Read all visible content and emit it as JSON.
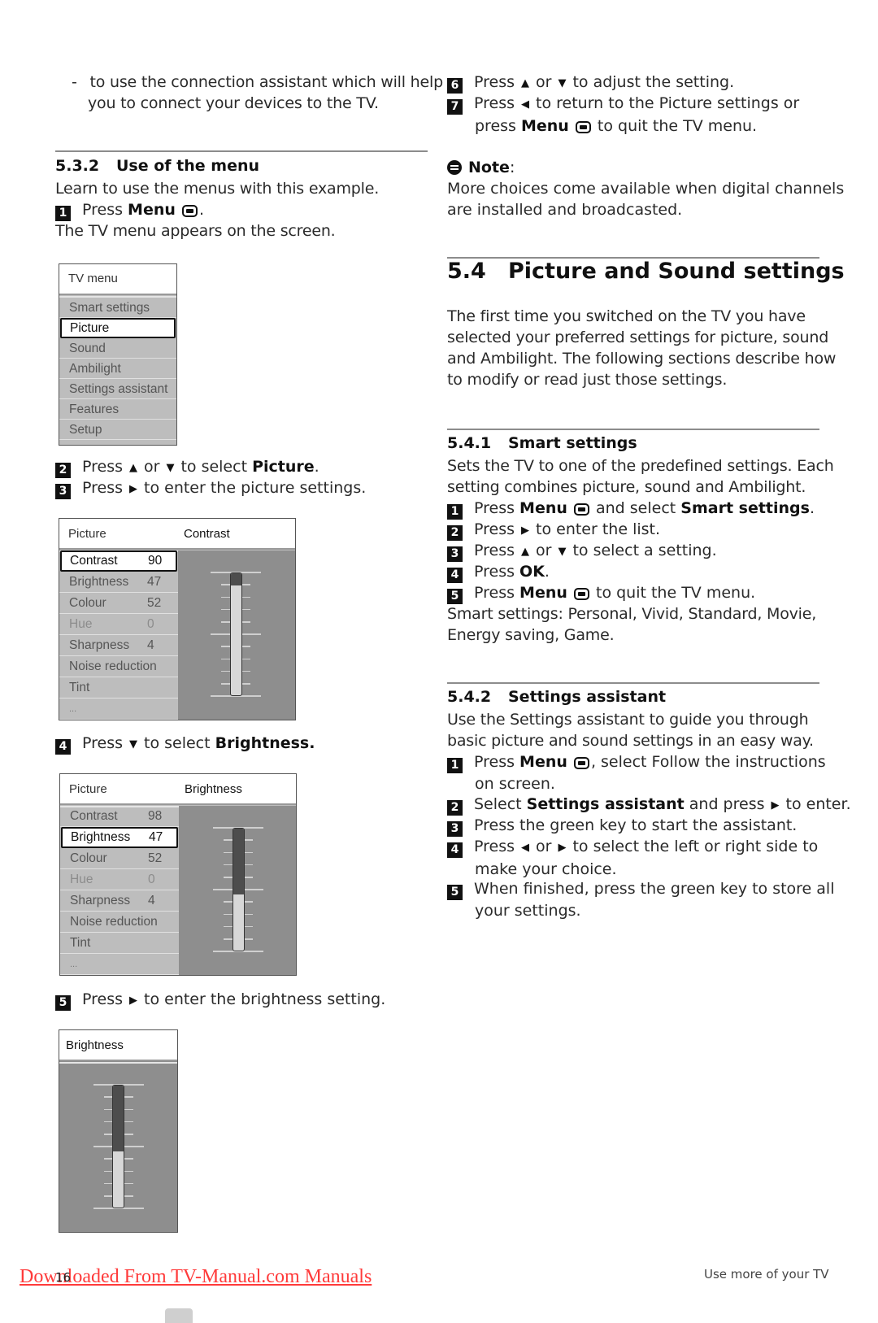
{
  "left": {
    "intro_bullet": {
      "dash": "-",
      "line1": "to use the connection assistant which will help",
      "line2": "you to connect your devices to the TV."
    },
    "section_532": {
      "number": "5.3.2",
      "title": "Use of the menu",
      "intro": "Learn to use the menus with this example.",
      "step1": {
        "n": "1",
        "pre": "Press ",
        "bold": "Menu",
        "post": "."
      },
      "after_step1": "The TV menu appears on the screen.",
      "step2": {
        "n": "2",
        "pre": "Press",
        "up": "▲",
        "or": "or",
        "down": "▼",
        "mid": "to select ",
        "bold": "Picture",
        "post": "."
      },
      "step3": {
        "n": "3",
        "pre": "Press",
        "right": "▶",
        "post": "to enter the picture settings."
      },
      "step4": {
        "n": "4",
        "pre": "Press",
        "down": "▼",
        "mid": "to select ",
        "bold": "Brightness."
      },
      "step5": {
        "n": "5",
        "pre": "Press",
        "right": "▶",
        "post": "to enter the brightness setting."
      }
    },
    "tv_menu": {
      "title": "TV menu",
      "items": [
        "Smart settings",
        "Picture",
        "Sound",
        "Ambilight",
        "Settings assistant",
        "Features",
        "Setup"
      ],
      "selected_index": 1
    },
    "picture_contrast": {
      "title": "Picture",
      "right_title": "Contrast",
      "rows": [
        {
          "label": "Contrast",
          "value": "90"
        },
        {
          "label": "Brightness",
          "value": "47"
        },
        {
          "label": "Colour",
          "value": "52"
        },
        {
          "label": "Hue",
          "value": "0"
        },
        {
          "label": "Sharpness",
          "value": "4"
        },
        {
          "label": "Noise reduction",
          "value": ""
        },
        {
          "label": "Tint",
          "value": ""
        },
        {
          "label": "...",
          "value": ""
        }
      ],
      "selected_index": 0,
      "slider_level_percent": 90
    },
    "picture_brightness": {
      "title": "Picture",
      "right_title": "Brightness",
      "rows": [
        {
          "label": "Contrast",
          "value": "98"
        },
        {
          "label": "Brightness",
          "value": "47"
        },
        {
          "label": "Colour",
          "value": "52"
        },
        {
          "label": "Hue",
          "value": "0"
        },
        {
          "label": "Sharpness",
          "value": "4"
        },
        {
          "label": "Noise reduction",
          "value": ""
        },
        {
          "label": "Tint",
          "value": ""
        },
        {
          "label": "...",
          "value": ""
        }
      ],
      "selected_index": 1,
      "slider_level_percent": 47
    },
    "brightness_only": {
      "title": "Brightness",
      "slider_level_percent": 47
    }
  },
  "right": {
    "step6": {
      "n": "6",
      "pre": "Press",
      "up": "▲",
      "or": "or",
      "down": "▼",
      "post": "to adjust the setting."
    },
    "step7": {
      "n": "7",
      "pre": "Press",
      "left": "◀",
      "post": "to return to the Picture settings or",
      "line2_pre": "press ",
      "line2_bold": "Menu",
      "line2_post": " to quit the TV menu."
    },
    "note": {
      "label": "Note",
      "colon": ":",
      "line1": "More choices come available when digital channels",
      "line2": "are installed and broadcasted."
    },
    "section_54": {
      "number": "5.4",
      "title": "Picture and Sound settings",
      "body": [
        "The first time you switched on the TV you have",
        "selected your preferred settings for picture, sound",
        "and Ambilight. The following sections describe how",
        "to modify or read just those settings."
      ]
    },
    "section_541": {
      "number": "5.4.1",
      "title": "Smart settings",
      "body": [
        "Sets the TV to one of the predefined settings. Each",
        "setting combines picture, sound and Ambilight."
      ],
      "step1": {
        "n": "1",
        "pre": "Press ",
        "bold": "Menu",
        "mid": " and select ",
        "bold2": "Smart settings",
        "post": "."
      },
      "step2": {
        "n": "2",
        "pre": "Press",
        "right": "▶",
        "post": "to enter the list."
      },
      "step3": {
        "n": "3",
        "pre": "Press",
        "up": "▲",
        "or": "or",
        "down": "▼",
        "post": "to select a setting."
      },
      "step4": {
        "n": "4",
        "pre": "Press ",
        "bold": "OK",
        "post": "."
      },
      "step5": {
        "n": "5",
        "pre": "Press ",
        "bold": "Menu",
        "post": " to quit the TV menu."
      },
      "tail": [
        "Smart settings: Personal, Vivid, Standard, Movie,",
        "Energy saving, Game."
      ]
    },
    "section_542": {
      "number": "5.4.2",
      "title": "Settings assistant",
      "body": [
        "Use the Settings assistant to guide you through",
        "basic picture and sound settings in an easy way."
      ],
      "step1": {
        "n": "1",
        "pre": "Press ",
        "bold": "Menu",
        "post": ", select Follow the instructions",
        "line2": "on screen."
      },
      "step2": {
        "n": "2",
        "pre": "Select ",
        "bold": "Settings assistant",
        "mid": " and press",
        "right": "▶",
        "post": "to enter."
      },
      "step3": {
        "n": "3",
        "text": "Press the green key to start the assistant."
      },
      "step4": {
        "n": "4",
        "pre": "Press",
        "left": "◀",
        "or": "or",
        "right": "▶",
        "post": "to select the left or right side to",
        "line2": "make your choice."
      },
      "step5": {
        "n": "5",
        "text": "When finished, press the green key to store all",
        "line2": "your settings."
      }
    }
  },
  "footer": {
    "page_number": "16",
    "section_label": "Use more of your TV",
    "watermark": "Downloaded From TV-Manual.com Manuals"
  },
  "colors": {
    "watermark": "#ff3a3a",
    "tv_panel": "#8e8e8e",
    "tv_list": "#bdbdbd"
  }
}
